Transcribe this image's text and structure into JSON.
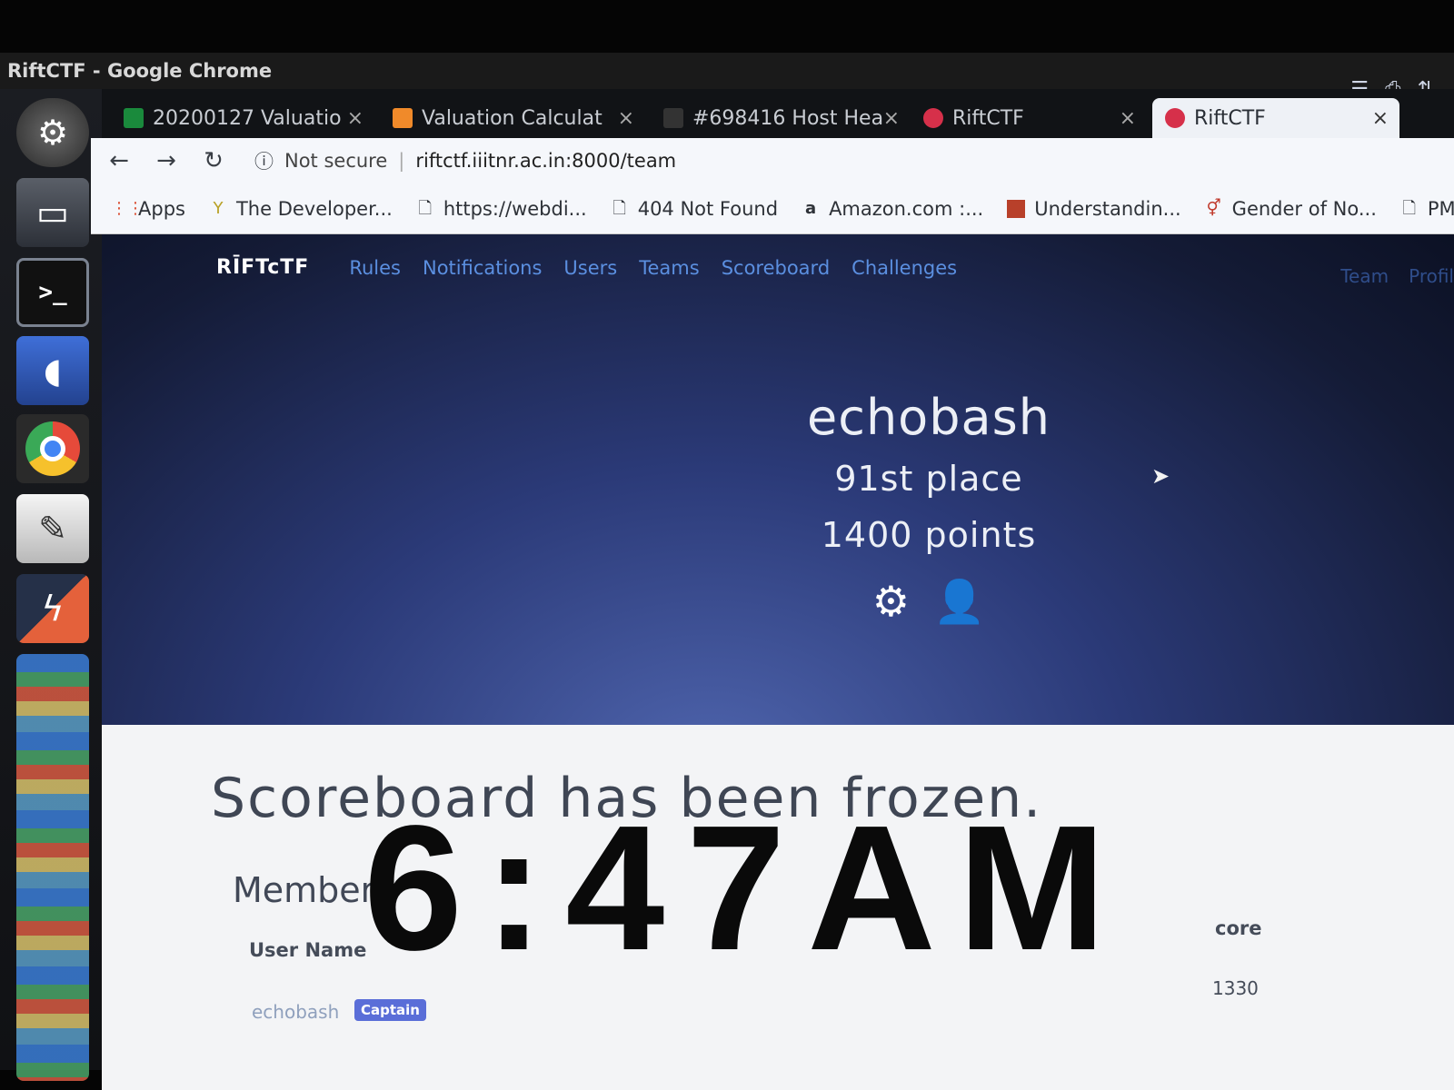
{
  "window": {
    "title": "RiftCTF - Google Chrome"
  },
  "tray": {
    "icons": [
      "menu-icon",
      "printer-icon",
      "transfer-icon"
    ]
  },
  "launcher": {
    "icons": [
      "ubuntu-icon",
      "files-icon",
      "terminal-icon",
      "mysql-workbench-icon",
      "chrome-icon",
      "text-editor-icon",
      "zap-icon",
      "app-stack-icon"
    ],
    "terminal_glyph": ">_"
  },
  "tabs": [
    {
      "label": "20200127 Valuatio",
      "favicon_color": "#1a8a3c"
    },
    {
      "label": "Valuation Calculat",
      "favicon_color": "#f08a2a"
    },
    {
      "label": "#698416 Host Hea",
      "favicon_color": "#333333"
    },
    {
      "label": "RiftCTF",
      "favicon_color": "#d6304a"
    },
    {
      "label": "RiftCTF",
      "favicon_color": "#d6304a",
      "active": true
    }
  ],
  "toolbar": {
    "security": "Not secure",
    "url": "riftctf.iiitnr.ac.in:8000/team"
  },
  "bookmarks": [
    {
      "label": "Apps",
      "icon": "apps-grid-icon"
    },
    {
      "label": "The Developer...",
      "icon": "developer-icon"
    },
    {
      "label": "https://webdi...",
      "icon": "page-icon"
    },
    {
      "label": "404 Not Found",
      "icon": "page-icon"
    },
    {
      "label": "Amazon.com :...",
      "icon": "amazon-icon"
    },
    {
      "label": "Understandin...",
      "icon": "book-icon"
    },
    {
      "label": "Gender of No...",
      "icon": "gender-icon"
    },
    {
      "label": "PM",
      "icon": "page-icon"
    }
  ],
  "nav": {
    "brand": "RĪFTcTF",
    "links": [
      "Rules",
      "Notifications",
      "Users",
      "Teams",
      "Scoreboard",
      "Challenges"
    ],
    "right_links": [
      "Team",
      "Profil"
    ]
  },
  "team": {
    "name": "echobash",
    "place": "91st place",
    "points": "1400 points"
  },
  "notice": "Scoreboard has been frozen.",
  "members": {
    "heading": "Members",
    "col_user": "User Name",
    "col_score": "core",
    "rows": [
      {
        "user": "echobash",
        "badge": "Captain",
        "score": "1330"
      }
    ]
  },
  "clock": "6:47AM"
}
